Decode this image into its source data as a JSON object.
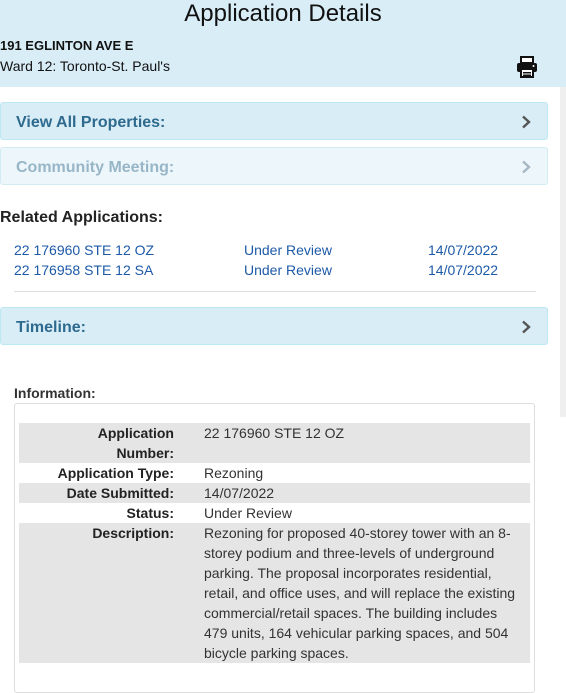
{
  "header": {
    "title": "Application Details",
    "address": "191 EGLINTON AVE E",
    "ward": "Ward 12: Toronto-St. Paul's",
    "print_icon": "printer-icon"
  },
  "accordions": {
    "view_all": "View All Properties:",
    "community": "Community Meeting:",
    "timeline": "Timeline:",
    "chevron_icon": "chevron-right-icon"
  },
  "related": {
    "title": "Related Applications:",
    "rows": [
      {
        "number": "22 176960 STE 12 OZ",
        "status": "Under Review",
        "date": "14/07/2022"
      },
      {
        "number": "22 176958 STE 12 SA",
        "status": "Under Review",
        "date": "14/07/2022"
      }
    ]
  },
  "information": {
    "title": "Information:",
    "fields": [
      {
        "label": "Application Number:",
        "value": "22 176960 STE 12 OZ"
      },
      {
        "label": "Application Type:",
        "value": "Rezoning"
      },
      {
        "label": "Date Submitted:",
        "value": "14/07/2022"
      },
      {
        "label": "Status:",
        "value": "Under Review"
      },
      {
        "label": "Description:",
        "value": "Rezoning for proposed 40-storey tower with an 8-storey podium and three-levels of underground parking. The proposal incorporates residential, retail, and office uses, and will replace the existing commercial/retail spaces. The building includes 479 units, 164 vehicular parking spaces, and 504 bicycle parking spaces."
      }
    ]
  },
  "colors": {
    "header_bg": "#d9edf7",
    "accordion_text": "#2e6a8e",
    "link": "#1d5aa8",
    "shade_row": "#e5e5e5"
  }
}
